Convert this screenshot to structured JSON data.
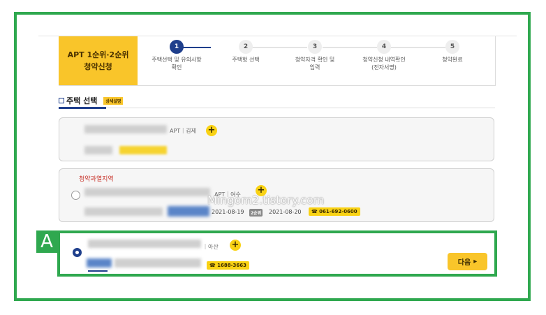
{
  "stepper": {
    "title_line1": "APT 1순위·2순위",
    "title_line2": "청약신청",
    "steps": [
      {
        "num": "1",
        "label": "주택선택 및 유의사항\n확인"
      },
      {
        "num": "2",
        "label": "주택형 선택"
      },
      {
        "num": "3",
        "label": "청약자격 확인 및\n입력"
      },
      {
        "num": "4",
        "label": "청약신청 내역확인\n(전자서명)"
      },
      {
        "num": "5",
        "label": "청약완료"
      }
    ]
  },
  "section": {
    "title": "주택 선택",
    "detail_badge": "상세설명"
  },
  "cards": [
    {
      "name_suffix": "APT｜김제",
      "plus": "+"
    },
    {
      "zone_tag": "청약과열지역",
      "name_suffix": "APT｜여수",
      "plus": "+",
      "date1": "2021-08-19",
      "rank_badge": "2순위",
      "date2": "2021-08-20",
      "phone": "☎ 061-692-0600"
    },
    {
      "name_suffix": "｜아산",
      "plus": "+",
      "phone": "☎ 1688-3663"
    }
  ],
  "next_button": {
    "label": "다음",
    "arrow": "▸"
  },
  "annotation": {
    "label": "A"
  },
  "watermark": "Mingom2.tistory.com",
  "colors": {
    "accent_green": "#2fa84f",
    "brand_yellow": "#f9c52a",
    "navy": "#1f3f8c",
    "zone_red": "#c8342b"
  }
}
